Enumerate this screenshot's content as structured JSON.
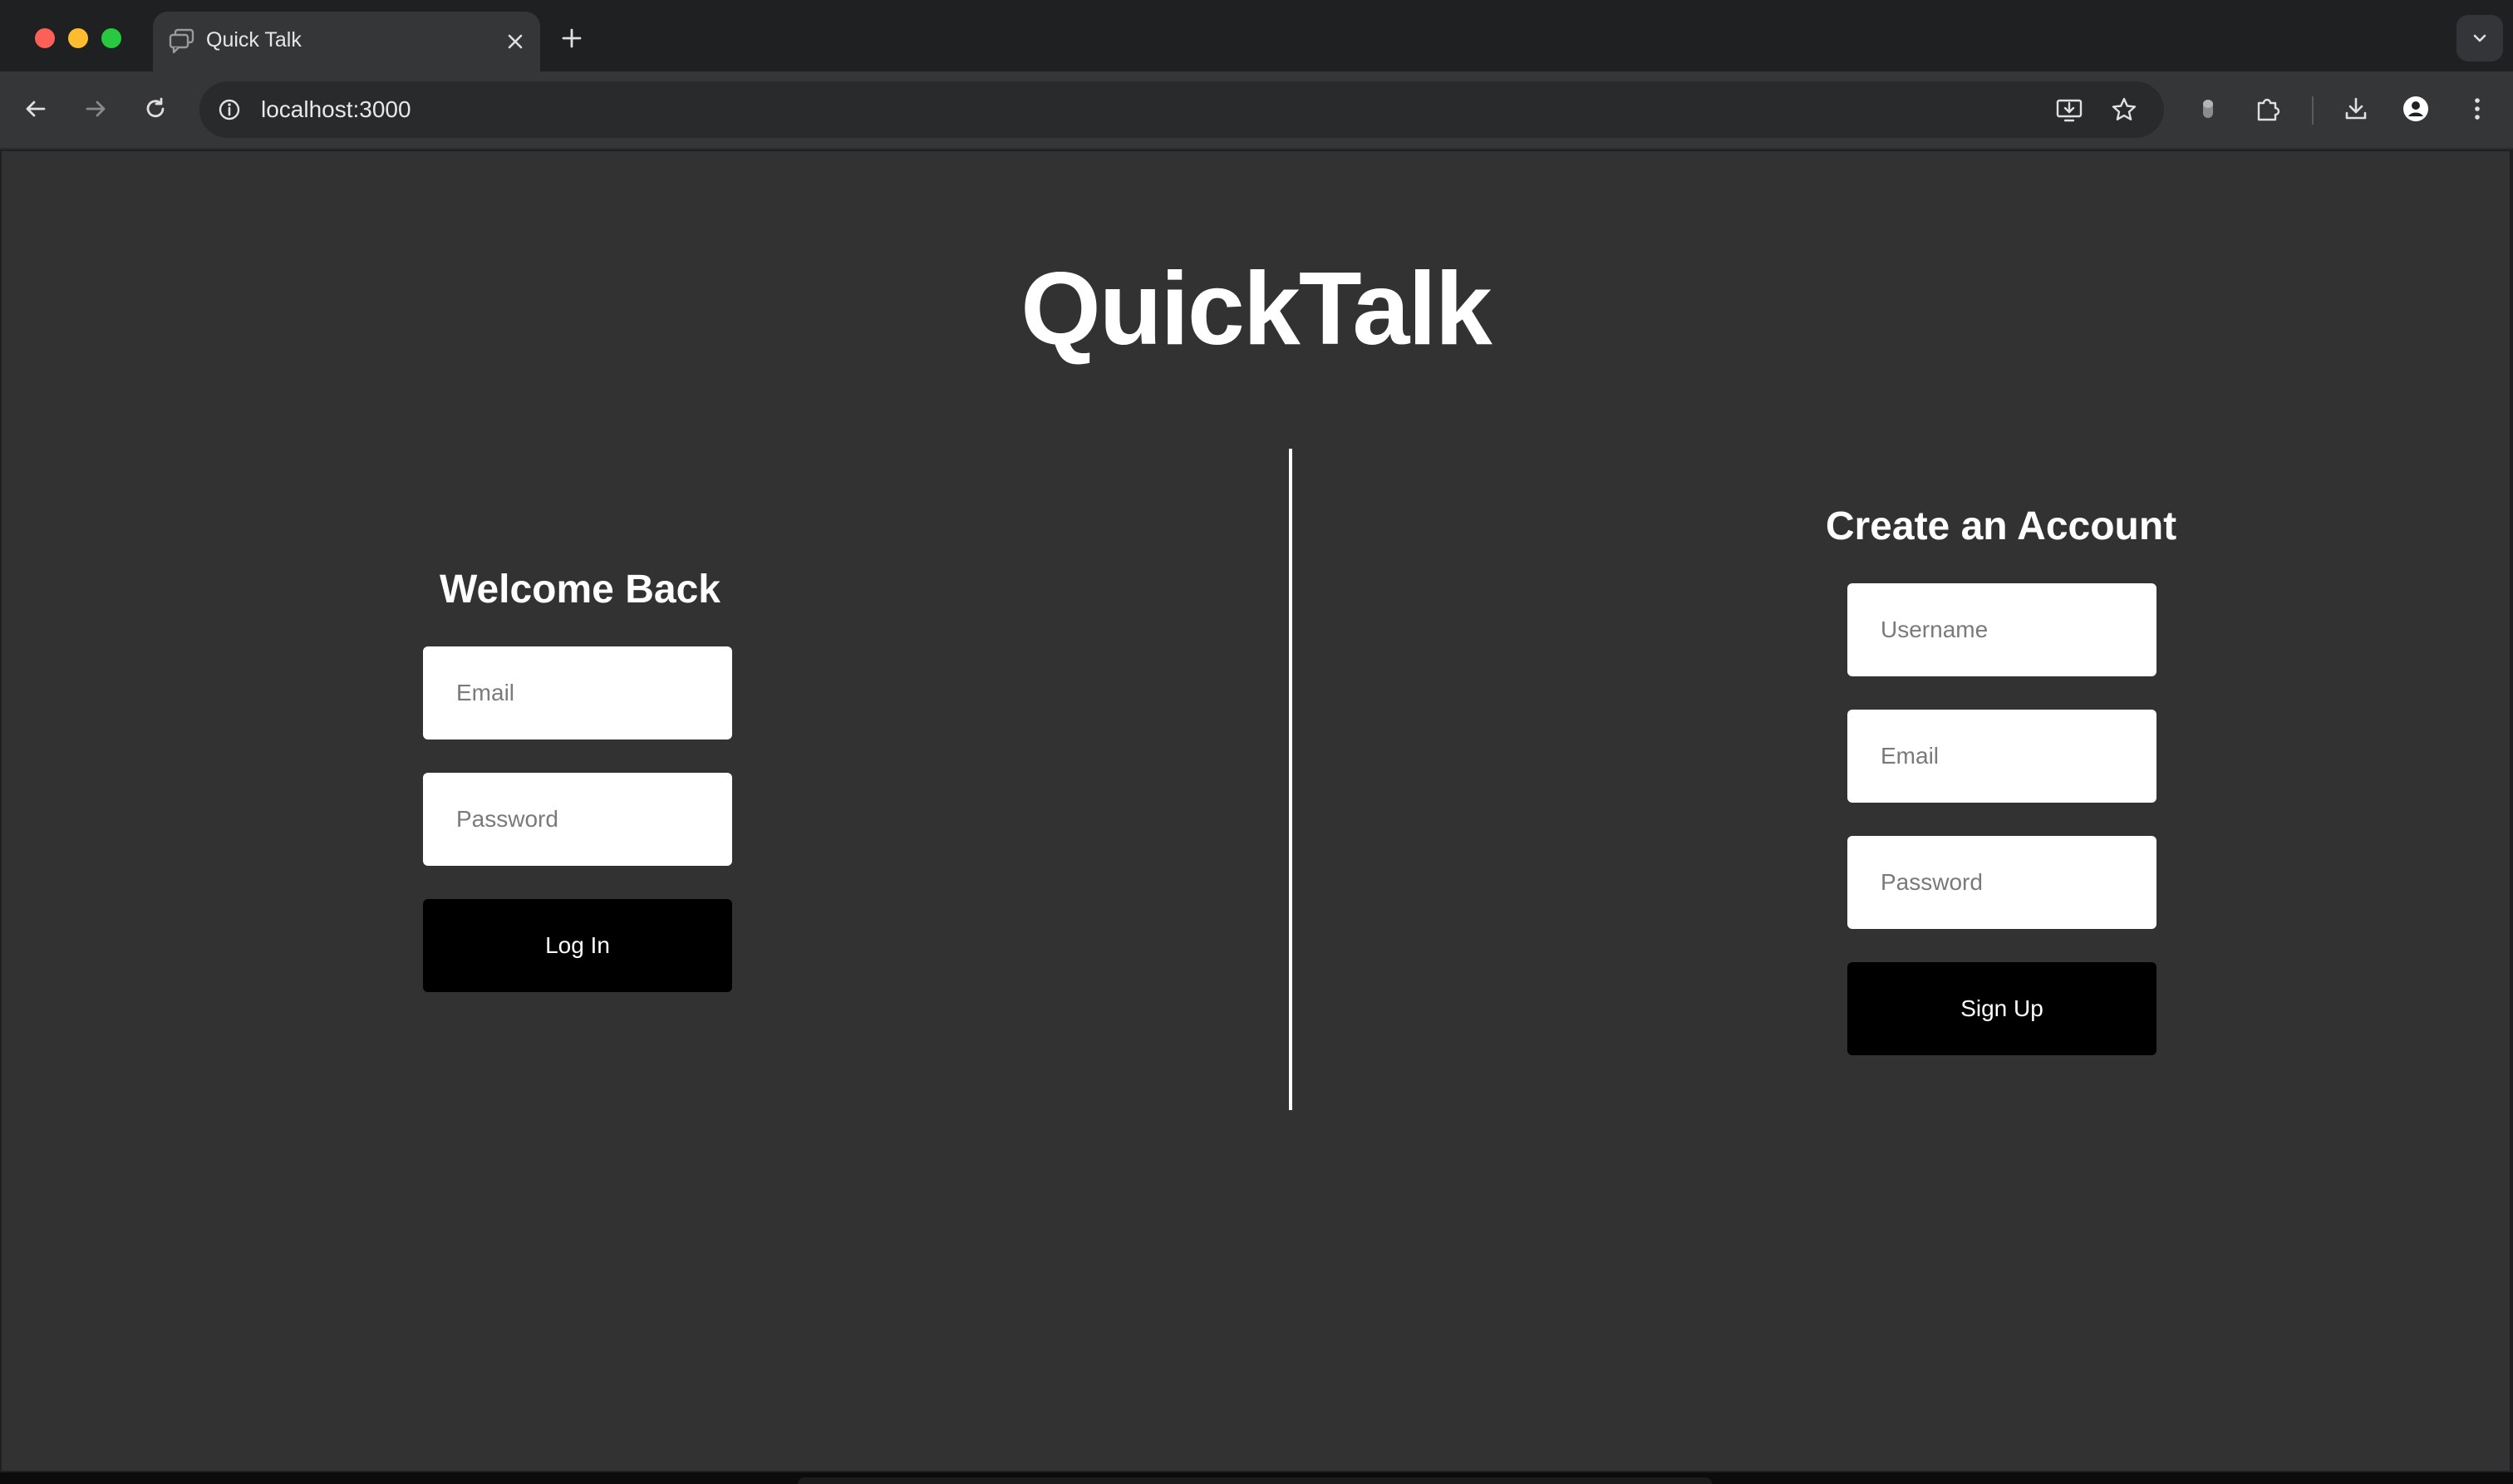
{
  "browser": {
    "tab_title": "Quick Talk",
    "url": "localhost:3000",
    "icons": {
      "back": "arrow-left-icon",
      "forward": "arrow-right-icon",
      "reload": "reload-icon",
      "site_info": "info-icon",
      "install": "install-app-icon",
      "bookmark": "star-icon",
      "extension_status": "extension-status-icon",
      "extensions": "puzzle-icon",
      "downloads": "download-icon",
      "profile": "profile-icon",
      "menu": "kebab-menu-icon",
      "new_tab": "plus-icon",
      "close_tab": "close-icon",
      "tab_search": "chevron-down-icon"
    }
  },
  "page": {
    "title": "QuickTalk",
    "login": {
      "heading": "Welcome Back",
      "email_placeholder": "Email",
      "password_placeholder": "Password",
      "submit_label": "Log In"
    },
    "signup": {
      "heading": "Create an Account",
      "username_placeholder": "Username",
      "email_placeholder": "Email",
      "password_placeholder": "Password",
      "submit_label": "Sign Up"
    }
  },
  "colors": {
    "page_background": "#323232",
    "button_background": "#000000",
    "field_background": "#ffffff",
    "text": "#ffffff"
  }
}
